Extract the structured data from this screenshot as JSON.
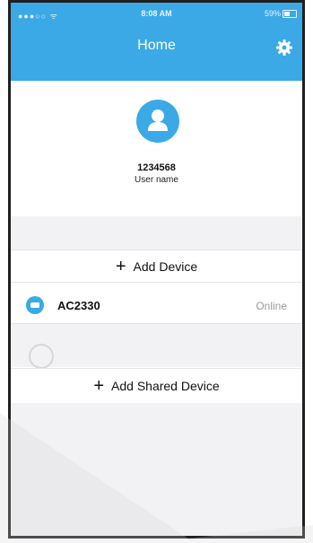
{
  "status_bar": {
    "carrier": "●●●○○ ᯤ",
    "time": "8:08 AM",
    "battery": "59%"
  },
  "header": {
    "title": "Home",
    "settings_icon": "gear-icon",
    "color": "#3aa9e6"
  },
  "profile": {
    "user_id": "1234568",
    "user_name": "User name",
    "avatar_icon": "person-icon"
  },
  "actions": {
    "add_device_label": "Add Device",
    "add_shared_device_label": "Add Shared Device",
    "plus_icon": "plus-icon"
  },
  "devices": [
    {
      "name": "AC2330",
      "status": "Online",
      "icon": "air-conditioner-icon"
    }
  ]
}
